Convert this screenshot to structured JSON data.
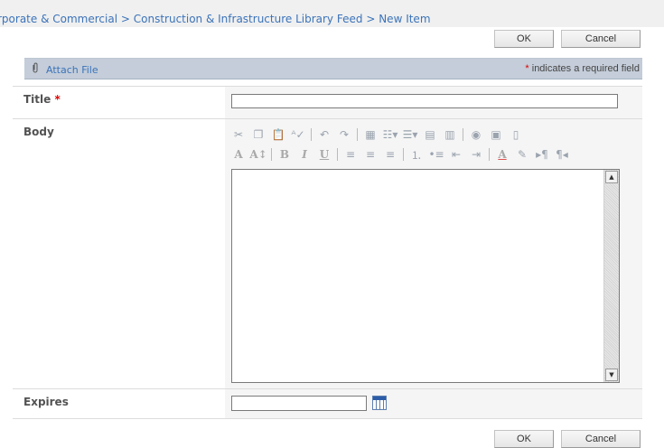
{
  "breadcrumb": {
    "items": [
      "rporate & Commercial",
      "Construction & Infrastructure Library Feed",
      "New Item"
    ],
    "separator": ">"
  },
  "buttons": {
    "ok_label": "OK",
    "cancel_label": "Cancel"
  },
  "toolbar": {
    "attach_label": "Attach File",
    "required_star": "*",
    "required_note": "indicates a required field"
  },
  "form": {
    "title_label": "Title",
    "title_required_star": "*",
    "title_value": "",
    "body_label": "Body",
    "expires_label": "Expires",
    "expires_value": ""
  },
  "rte": {
    "row1": [
      "cut-icon",
      "copy-icon",
      "paste-icon",
      "spellcheck-icon",
      "undo-icon",
      "redo-icon",
      "insert-table-icon",
      "insert-link-icon",
      "bookmark-icon",
      "table-props-icon",
      "cell-props-icon",
      "insert-image-icon",
      "image-props-icon",
      "html-source-icon"
    ],
    "row2": [
      "font-icon",
      "font-size-icon",
      "bold-icon",
      "italic-icon",
      "underline-icon",
      "align-left-icon",
      "align-center-icon",
      "align-right-icon",
      "numbered-list-icon",
      "bullet-list-icon",
      "outdent-icon",
      "indent-icon",
      "text-color-icon",
      "highlight-icon",
      "ltr-icon",
      "rtl-icon"
    ]
  },
  "colors": {
    "link": "#3b73b9",
    "required": "#e00000",
    "toolbar_bg": "#c4cdd9"
  }
}
